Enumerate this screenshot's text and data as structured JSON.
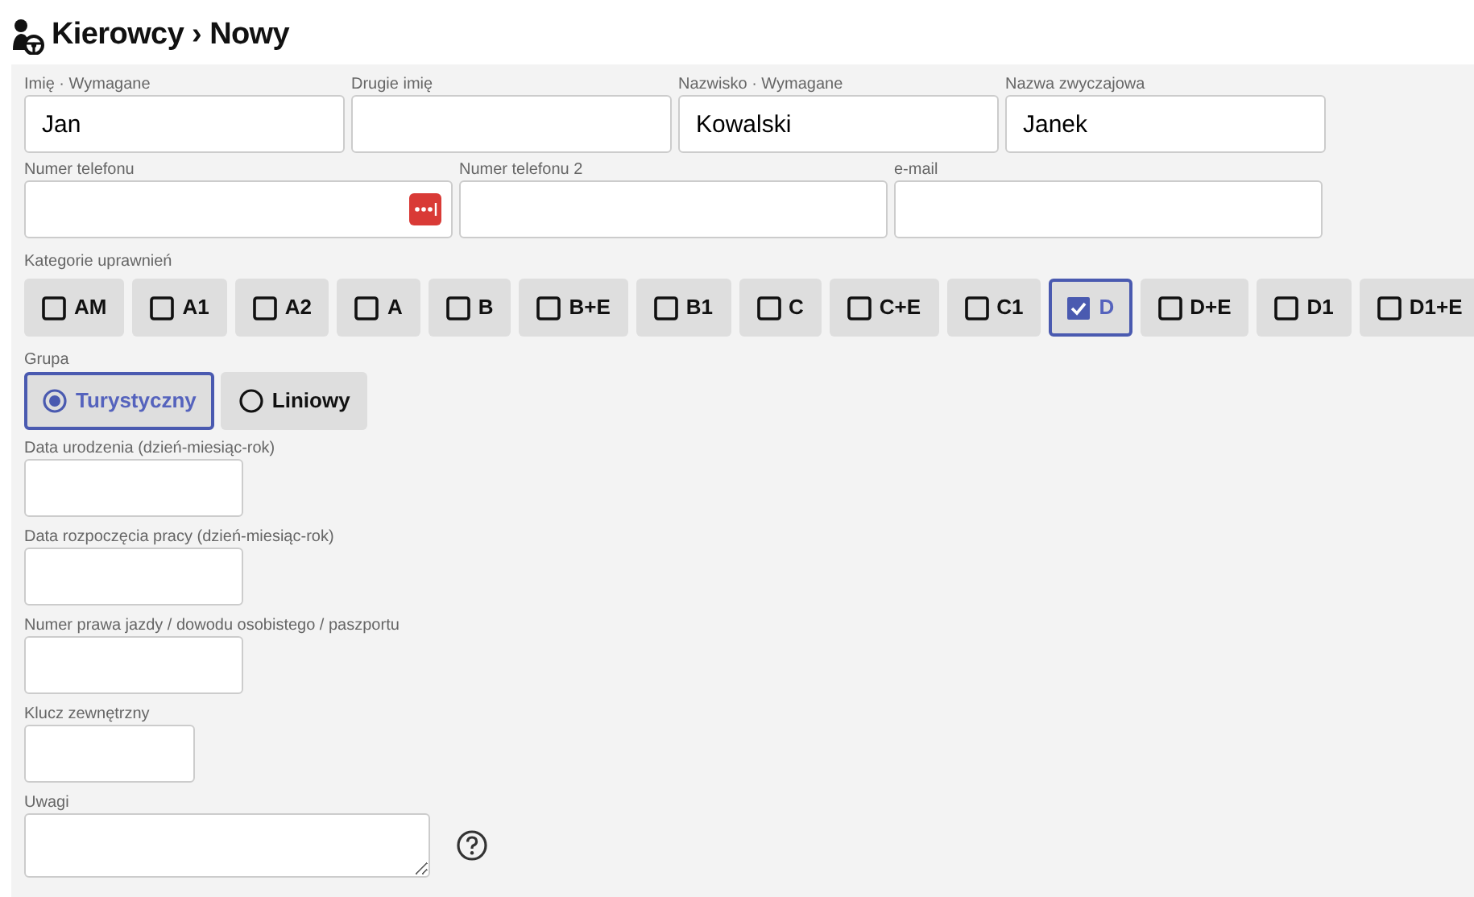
{
  "title": "Kierowcy › Nowy",
  "name_row": [
    {
      "label": "Imię · Wymagane",
      "value": "Jan"
    },
    {
      "label": "Drugie imię"
    },
    {
      "label": "Nazwisko · Wymagane",
      "value": "Kowalski"
    },
    {
      "label": "Nazwa zwyczajowa",
      "value": "Janek"
    }
  ],
  "contact_row": [
    {
      "label": "Numer telefonu",
      "kind": "phone"
    },
    {
      "label": "Numer telefonu 2",
      "kind": "text"
    },
    {
      "label": "e-mail",
      "kind": "text"
    }
  ],
  "categories": {
    "label": "Kategorie uprawnień",
    "items": [
      {
        "label": "AM",
        "checked": false
      },
      {
        "label": "A1",
        "checked": false
      },
      {
        "label": "A2",
        "checked": false
      },
      {
        "label": "A",
        "checked": false
      },
      {
        "label": "B",
        "checked": false
      },
      {
        "label": "B+E",
        "checked": false
      },
      {
        "label": "B1",
        "checked": false
      },
      {
        "label": "C",
        "checked": false
      },
      {
        "label": "C+E",
        "checked": false
      },
      {
        "label": "C1",
        "checked": false
      },
      {
        "label": "D",
        "checked": true
      },
      {
        "label": "D+E",
        "checked": false
      },
      {
        "label": "D1",
        "checked": false
      },
      {
        "label": "D1+E",
        "checked": false
      }
    ]
  },
  "group": {
    "label": "Grupa",
    "options": [
      {
        "label": "Turystyczny",
        "selected": true
      },
      {
        "label": "Liniowy",
        "selected": false
      }
    ]
  },
  "stacked_fields": [
    {
      "label": "Data urodzenia (dzień-miesiąc-rok)"
    },
    {
      "label": "Data rozpoczęcia pracy (dzień-miesiąc-rok)"
    },
    {
      "label": "Numer prawa jazdy / dowodu osobistego / paszportu"
    },
    {
      "label": "Klucz zewnętrzny"
    }
  ],
  "notes": {
    "label": "Uwagi"
  }
}
